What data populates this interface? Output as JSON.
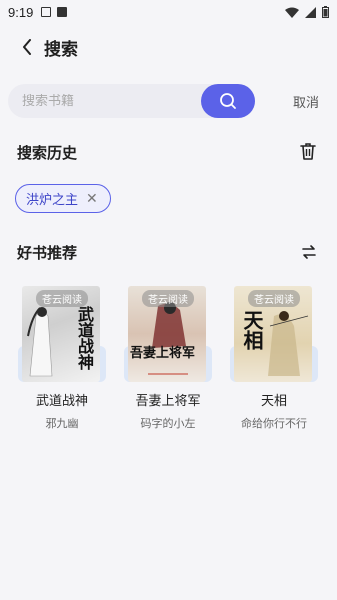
{
  "status": {
    "time": "9:19"
  },
  "header": {
    "title": "搜索"
  },
  "search": {
    "placeholder": "搜索书籍",
    "cancel_label": "取消"
  },
  "history": {
    "title": "搜索历史",
    "items": [
      {
        "label": "洪炉之主"
      }
    ]
  },
  "recommend": {
    "title": "好书推荐",
    "books": [
      {
        "title": "武道战神",
        "author": "邪九幽",
        "tag": "苍云阅读",
        "cover_text": "武道战神"
      },
      {
        "title": "吾妻上将军",
        "author": "码字的小左",
        "tag": "苍云阅读",
        "cover_text": "吾妻上将军"
      },
      {
        "title": "天相",
        "author": "命给你行不行",
        "tag": "苍云阅读",
        "cover_text": "天相"
      }
    ]
  },
  "colors": {
    "accent": "#5b62e8",
    "background": "#f5f5f8"
  }
}
